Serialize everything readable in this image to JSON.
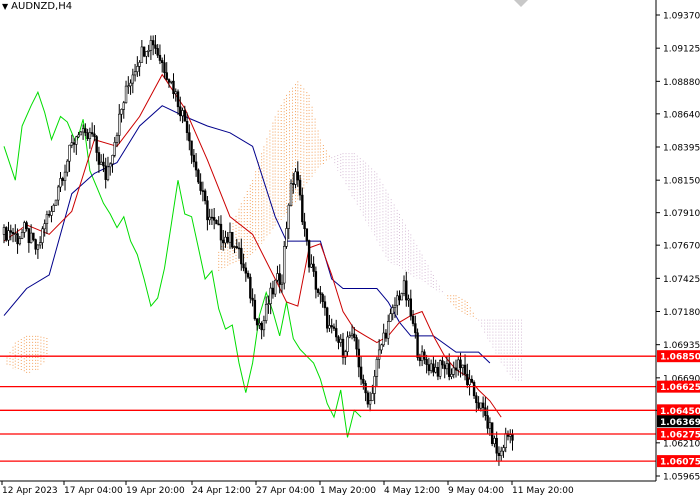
{
  "header": {
    "symbol_label": "AUDNZD,H4",
    "menu_icon": "triangle-down-icon"
  },
  "colors": {
    "background": "#ffffff",
    "candle": "#000000",
    "tenkan": "#cc0000",
    "kijun": "#00008b",
    "chikou": "#00dd00",
    "cloud_up": "#f4a460",
    "cloud_down": "#d8bfd8",
    "level_line": "#ff0000",
    "level_label_bg": "#ff0000",
    "level_label_text": "#ffffff",
    "current_label_bg": "#000000"
  },
  "chart_data": {
    "type": "candlestick",
    "symbol": "AUDNZD",
    "timeframe": "H4",
    "x_tick_labels": [
      "12 Apr 2023",
      "17 Apr 04:00",
      "19 Apr 20:00",
      "24 Apr 12:00",
      "27 Apr 04:00",
      "1 May 20:00",
      "4 May 12:00",
      "9 May 04:00",
      "11 May 20:00"
    ],
    "y_tick_labels": [
      "1.09370",
      "1.09125",
      "1.08880",
      "1.08640",
      "1.08395",
      "1.08150",
      "1.07910",
      "1.07670",
      "1.07425",
      "1.07180",
      "1.06935",
      "1.06690",
      "1.06450",
      "1.06210",
      "1.05965"
    ],
    "ylim": [
      1.05965,
      1.0937
    ],
    "close_path": [
      [
        0,
        1.0775
      ],
      [
        3,
        1.0778
      ],
      [
        6,
        1.0772
      ],
      [
        9,
        1.0778
      ],
      [
        12,
        1.077
      ],
      [
        15,
        1.0762
      ],
      [
        18,
        1.0785
      ],
      [
        21,
        1.079
      ],
      [
        24,
        1.0812
      ],
      [
        27,
        1.0825
      ],
      [
        30,
        1.084
      ],
      [
        33,
        1.0852
      ],
      [
        36,
        1.0845
      ],
      [
        39,
        1.0848
      ],
      [
        42,
        1.083
      ],
      [
        45,
        1.0818
      ],
      [
        48,
        1.0838
      ],
      [
        51,
        1.086
      ],
      [
        54,
        1.088
      ],
      [
        57,
        1.0895
      ],
      [
        60,
        1.0907
      ],
      [
        63,
        1.0915
      ],
      [
        66,
        1.0918
      ],
      [
        69,
        1.0905
      ],
      [
        72,
        1.0895
      ],
      [
        75,
        1.0883
      ],
      [
        78,
        1.0868
      ],
      [
        81,
        1.0855
      ],
      [
        84,
        1.083
      ],
      [
        87,
        1.0808
      ],
      [
        90,
        1.079
      ],
      [
        93,
        1.0782
      ],
      [
        96,
        1.0775
      ],
      [
        99,
        1.0772
      ],
      [
        102,
        1.077
      ],
      [
        105,
        1.0755
      ],
      [
        108,
        1.0738
      ],
      [
        111,
        1.0718
      ],
      [
        114,
        1.0705
      ],
      [
        117,
        1.0725
      ],
      [
        120,
        1.0738
      ],
      [
        123,
        1.0745
      ],
      [
        126,
        1.08
      ],
      [
        129,
        1.0822
      ],
      [
        132,
        1.079
      ],
      [
        135,
        1.0755
      ],
      [
        138,
        1.0738
      ],
      [
        141,
        1.0722
      ],
      [
        144,
        1.0705
      ],
      [
        147,
        1.0698
      ],
      [
        150,
        1.069
      ],
      [
        153,
        1.07
      ],
      [
        156,
        1.069
      ],
      [
        159,
        1.066
      ],
      [
        162,
        1.0652
      ],
      [
        165,
        1.068
      ],
      [
        168,
        1.07
      ],
      [
        171,
        1.0712
      ],
      [
        174,
        1.0728
      ],
      [
        177,
        1.0735
      ],
      [
        180,
        1.0715
      ],
      [
        183,
        1.069
      ],
      [
        186,
        1.068
      ],
      [
        189,
        1.0678
      ],
      [
        192,
        1.0675
      ],
      [
        195,
        1.0678
      ],
      [
        198,
        1.0672
      ],
      [
        201,
        1.0682
      ],
      [
        204,
        1.067
      ],
      [
        207,
        1.066
      ],
      [
        210,
        1.065
      ],
      [
        213,
        1.064
      ],
      [
        216,
        1.0625
      ],
      [
        219,
        1.061
      ],
      [
        222,
        1.0625
      ],
      [
        225,
        1.0628
      ]
    ],
    "tenkan": [
      [
        0,
        1.077
      ],
      [
        10,
        1.0782
      ],
      [
        20,
        1.0775
      ],
      [
        30,
        1.0792
      ],
      [
        40,
        1.0845
      ],
      [
        50,
        1.084
      ],
      [
        60,
        1.0862
      ],
      [
        70,
        1.0893
      ],
      [
        80,
        1.0868
      ],
      [
        90,
        1.083
      ],
      [
        100,
        1.0788
      ],
      [
        110,
        1.0775
      ],
      [
        120,
        1.0742
      ],
      [
        125,
        1.0725
      ],
      [
        130,
        1.0722
      ],
      [
        135,
        1.0765
      ],
      [
        140,
        1.0768
      ],
      [
        145,
        1.0745
      ],
      [
        150,
        1.0718
      ],
      [
        155,
        1.0705
      ],
      [
        160,
        1.07
      ],
      [
        165,
        1.0695
      ],
      [
        170,
        1.07
      ],
      [
        175,
        1.071
      ],
      [
        180,
        1.0715
      ],
      [
        185,
        1.0718
      ],
      [
        190,
        1.07
      ],
      [
        195,
        1.0685
      ],
      [
        200,
        1.0675
      ],
      [
        205,
        1.067
      ],
      [
        210,
        1.066
      ],
      [
        215,
        1.0652
      ],
      [
        220,
        1.064
      ]
    ],
    "kijun": [
      [
        0,
        1.0715
      ],
      [
        10,
        1.0735
      ],
      [
        20,
        1.0745
      ],
      [
        30,
        1.0805
      ],
      [
        40,
        1.082
      ],
      [
        50,
        1.0828
      ],
      [
        60,
        1.0855
      ],
      [
        70,
        1.087
      ],
      [
        80,
        1.0862
      ],
      [
        90,
        1.0855
      ],
      [
        100,
        1.085
      ],
      [
        110,
        1.084
      ],
      [
        120,
        1.0788
      ],
      [
        125,
        1.077
      ],
      [
        130,
        1.077
      ],
      [
        140,
        1.077
      ],
      [
        145,
        1.0742
      ],
      [
        150,
        1.0735
      ],
      [
        165,
        1.0735
      ],
      [
        170,
        1.0725
      ],
      [
        175,
        1.071
      ],
      [
        180,
        1.07
      ],
      [
        190,
        1.07
      ],
      [
        200,
        1.0688
      ],
      [
        205,
        1.0688
      ],
      [
        210,
        1.0688
      ],
      [
        215,
        1.068
      ]
    ],
    "chikou": [
      [
        0,
        1.084
      ],
      [
        5,
        1.0815
      ],
      [
        8,
        1.0855
      ],
      [
        12,
        1.087
      ],
      [
        15,
        1.088
      ],
      [
        18,
        1.0865
      ],
      [
        21,
        1.0845
      ],
      [
        25,
        1.0862
      ],
      [
        28,
        1.0858
      ],
      [
        32,
        1.0842
      ],
      [
        35,
        1.086
      ],
      [
        38,
        1.0822
      ],
      [
        41,
        1.081
      ],
      [
        44,
        1.0798
      ],
      [
        47,
        1.079
      ],
      [
        50,
        1.078
      ],
      [
        53,
        1.0788
      ],
      [
        56,
        1.077
      ],
      [
        59,
        1.076
      ],
      [
        62,
        1.0742
      ],
      [
        65,
        1.0722
      ],
      [
        68,
        1.0728
      ],
      [
        71,
        1.075
      ],
      [
        74,
        1.0782
      ],
      [
        77,
        1.0815
      ],
      [
        80,
        1.079
      ],
      [
        83,
        1.0788
      ],
      [
        86,
        1.0765
      ],
      [
        89,
        1.0742
      ],
      [
        92,
        1.0748
      ],
      [
        95,
        1.072
      ],
      [
        98,
        1.0705
      ],
      [
        101,
        1.0708
      ],
      [
        104,
        1.068
      ],
      [
        107,
        1.0658
      ],
      [
        110,
        1.068
      ],
      [
        113,
        1.0715
      ],
      [
        116,
        1.0732
      ],
      [
        119,
        1.0718
      ],
      [
        122,
        1.07
      ],
      [
        125,
        1.0725
      ],
      [
        128,
        1.0698
      ],
      [
        131,
        1.069
      ],
      [
        134,
        1.0685
      ],
      [
        137,
        1.068
      ],
      [
        140,
        1.0668
      ],
      [
        143,
        1.065
      ],
      [
        146,
        1.064
      ],
      [
        149,
        1.066
      ],
      [
        152,
        1.0625
      ],
      [
        155,
        1.0645
      ],
      [
        158,
        1.064
      ]
    ],
    "cloud": [
      [
        95,
        1.0748,
        1.0762
      ],
      [
        100,
        1.0752,
        1.0778
      ],
      [
        105,
        1.0755,
        1.0798
      ],
      [
        110,
        1.076,
        1.0815
      ],
      [
        115,
        1.077,
        1.084
      ],
      [
        120,
        1.078,
        1.0862
      ],
      [
        125,
        1.079,
        1.0878
      ],
      [
        130,
        1.08,
        1.0888
      ],
      [
        135,
        1.0815,
        1.0878
      ],
      [
        140,
        1.0825,
        1.0845
      ],
      [
        145,
        1.0832,
        1.083
      ],
      [
        150,
        1.0835,
        1.0815
      ],
      [
        155,
        1.0835,
        1.08
      ],
      [
        160,
        1.0828,
        1.0785
      ],
      [
        165,
        1.082,
        1.077
      ],
      [
        170,
        1.0805,
        1.0755
      ],
      [
        175,
        1.079,
        1.075
      ],
      [
        180,
        1.0775,
        1.0745
      ],
      [
        185,
        1.076,
        1.074
      ],
      [
        190,
        1.0745,
        1.0735
      ],
      [
        195,
        1.073,
        1.073
      ],
      [
        200,
        1.072,
        1.073
      ],
      [
        205,
        1.0715,
        1.0725
      ],
      [
        210,
        1.0712,
        1.071
      ],
      [
        215,
        1.0712,
        1.0695
      ],
      [
        220,
        1.0712,
        1.068
      ],
      [
        225,
        1.0712,
        1.0668
      ],
      [
        230,
        1.0712,
        1.0665
      ]
    ],
    "cloud_left": [
      [
        0,
        1.068,
        1.068
      ],
      [
        5,
        1.0675,
        1.0695
      ],
      [
        10,
        1.0672,
        1.07
      ],
      [
        15,
        1.0675,
        1.07
      ],
      [
        20,
        1.0685,
        1.0698
      ]
    ],
    "levels": [
      {
        "label": "1.06850",
        "value": 1.0685
      },
      {
        "label": "1.06625",
        "value": 1.06625
      },
      {
        "label": "1.06450",
        "value": 1.0645
      },
      {
        "label": "1.06275",
        "value": 1.06275
      },
      {
        "label": "1.06075",
        "value": 1.06075
      }
    ],
    "current_price": {
      "label": "1.06369",
      "value": 1.06369
    },
    "grid": false,
    "legend": "none"
  }
}
